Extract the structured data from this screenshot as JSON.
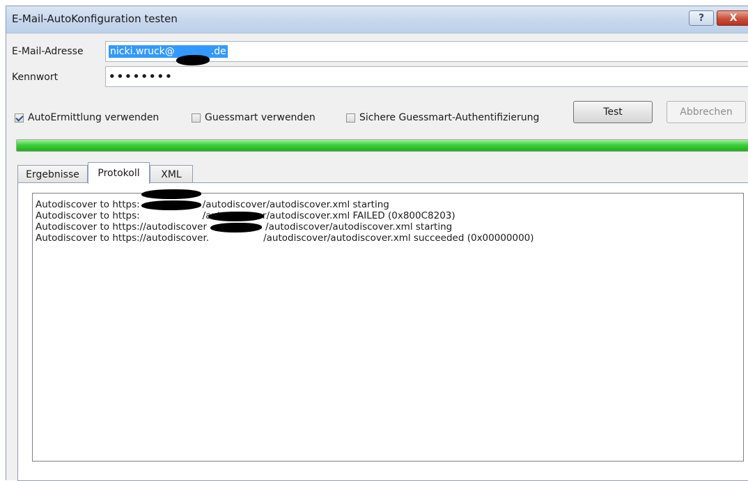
{
  "window": {
    "title": "E-Mail-AutoKonfiguration testen",
    "help_label": "?",
    "close_label": "X"
  },
  "form": {
    "email_label": "E-Mail-Adresse",
    "email_value_prefix": "nicki.wruck@",
    "email_value_suffix": ".de",
    "password_label": "Kennwort",
    "password_value": "••••••••"
  },
  "options": {
    "autodiscover": {
      "label": "AutoErmittlung verwenden",
      "checked": true
    },
    "guessmart": {
      "label": "Guessmart verwenden",
      "checked": false
    },
    "secure_guessmart": {
      "label": "Sichere Guessmart-Authentifizierung",
      "checked": false
    }
  },
  "buttons": {
    "test": "Test",
    "cancel": "Abbrechen"
  },
  "progress": {
    "value_percent": 100,
    "color": "#3fcf3c"
  },
  "tabs": [
    {
      "label": "Ergebnisse",
      "active": false
    },
    {
      "label": "Protokoll",
      "active": true
    },
    {
      "label": "XML",
      "active": false
    }
  ],
  "log": [
    {
      "prefix": "Autodiscover to https:",
      "suffix": "/autodiscover/autodiscover.xml starting"
    },
    {
      "prefix": "Autodiscover to https:",
      "suffix": "/autodiscover/autodiscover.xml FAILED (0x800C8203)"
    },
    {
      "prefix": "Autodiscover to https://autodiscover",
      "suffix": "/autodiscover/autodiscover.xml starting"
    },
    {
      "prefix": "Autodiscover to https://autodiscover.",
      "suffix": "/autodiscover/autodiscover.xml succeeded (0x00000000)"
    }
  ]
}
